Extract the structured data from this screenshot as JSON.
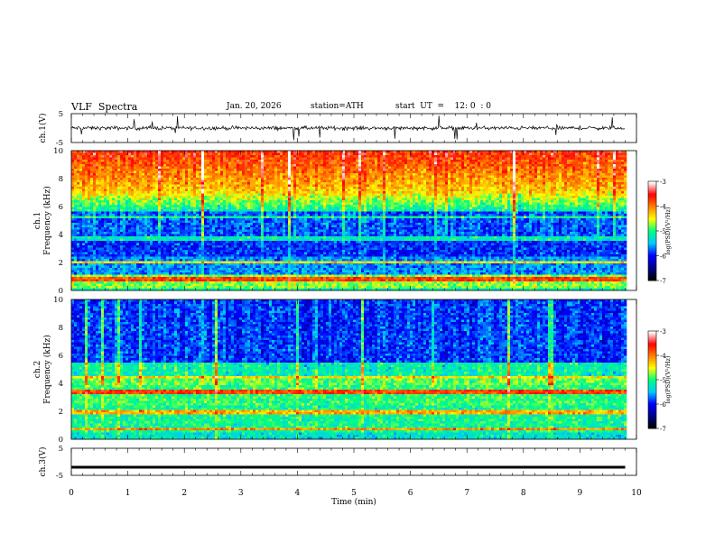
{
  "header": {
    "title": "VLF  Spectra",
    "date": "Jan. 20, 2026",
    "station": "station=ATH",
    "start": "start  UT  =    12: 0  : 0"
  },
  "chart_data": [
    {
      "type": "line",
      "name_label": "ch.1(V)",
      "ylim": [
        -5,
        5
      ],
      "yticks": [
        "5",
        "-5"
      ],
      "xlim": [
        0,
        10
      ],
      "series_range_approx": [
        -2,
        2
      ]
    },
    {
      "type": "heatmap",
      "ylabel": "ch.1\nFrequency (kHz)",
      "ylim": [
        0,
        10
      ],
      "yticks": [
        "10",
        "8",
        "6",
        "4",
        "2",
        "0"
      ],
      "xlim": [
        0,
        10
      ],
      "colorbar": {
        "label": "log(PSD)(V²/Hz)",
        "range": [
          -7,
          -3
        ],
        "ticks": [
          "-3",
          "-4",
          "-5",
          "-6",
          "-7"
        ]
      }
    },
    {
      "type": "heatmap",
      "ylabel": "ch.2\nFrequency (kHz)",
      "ylim": [
        0,
        10
      ],
      "yticks": [
        "10",
        "8",
        "6",
        "4",
        "2",
        "0"
      ],
      "xlim": [
        0,
        10
      ],
      "colorbar": {
        "label": "log(PSD)(V²/Hz)",
        "range": [
          -7,
          -3
        ],
        "ticks": [
          "-3",
          "-4",
          "-5",
          "-6",
          "-7"
        ]
      }
    },
    {
      "type": "line",
      "name_label": "ch.3(V)",
      "ylim": [
        -5,
        5
      ],
      "yticks": [
        "5",
        "-5"
      ],
      "xlim": [
        0,
        10
      ],
      "series_level_approx": -2
    }
  ],
  "xaxis": {
    "label": "Time  (min)",
    "ticks": [
      "0",
      "1",
      "2",
      "3",
      "4",
      "5",
      "6",
      "7",
      "8",
      "9",
      "10"
    ],
    "data_end": 9.8
  },
  "colors": {
    "colormap": [
      "#000000",
      "#00008b",
      "#0000ff",
      "#00c8ff",
      "#00ff80",
      "#ffff00",
      "#ff8000",
      "#ff0000",
      "#ffffff"
    ]
  }
}
